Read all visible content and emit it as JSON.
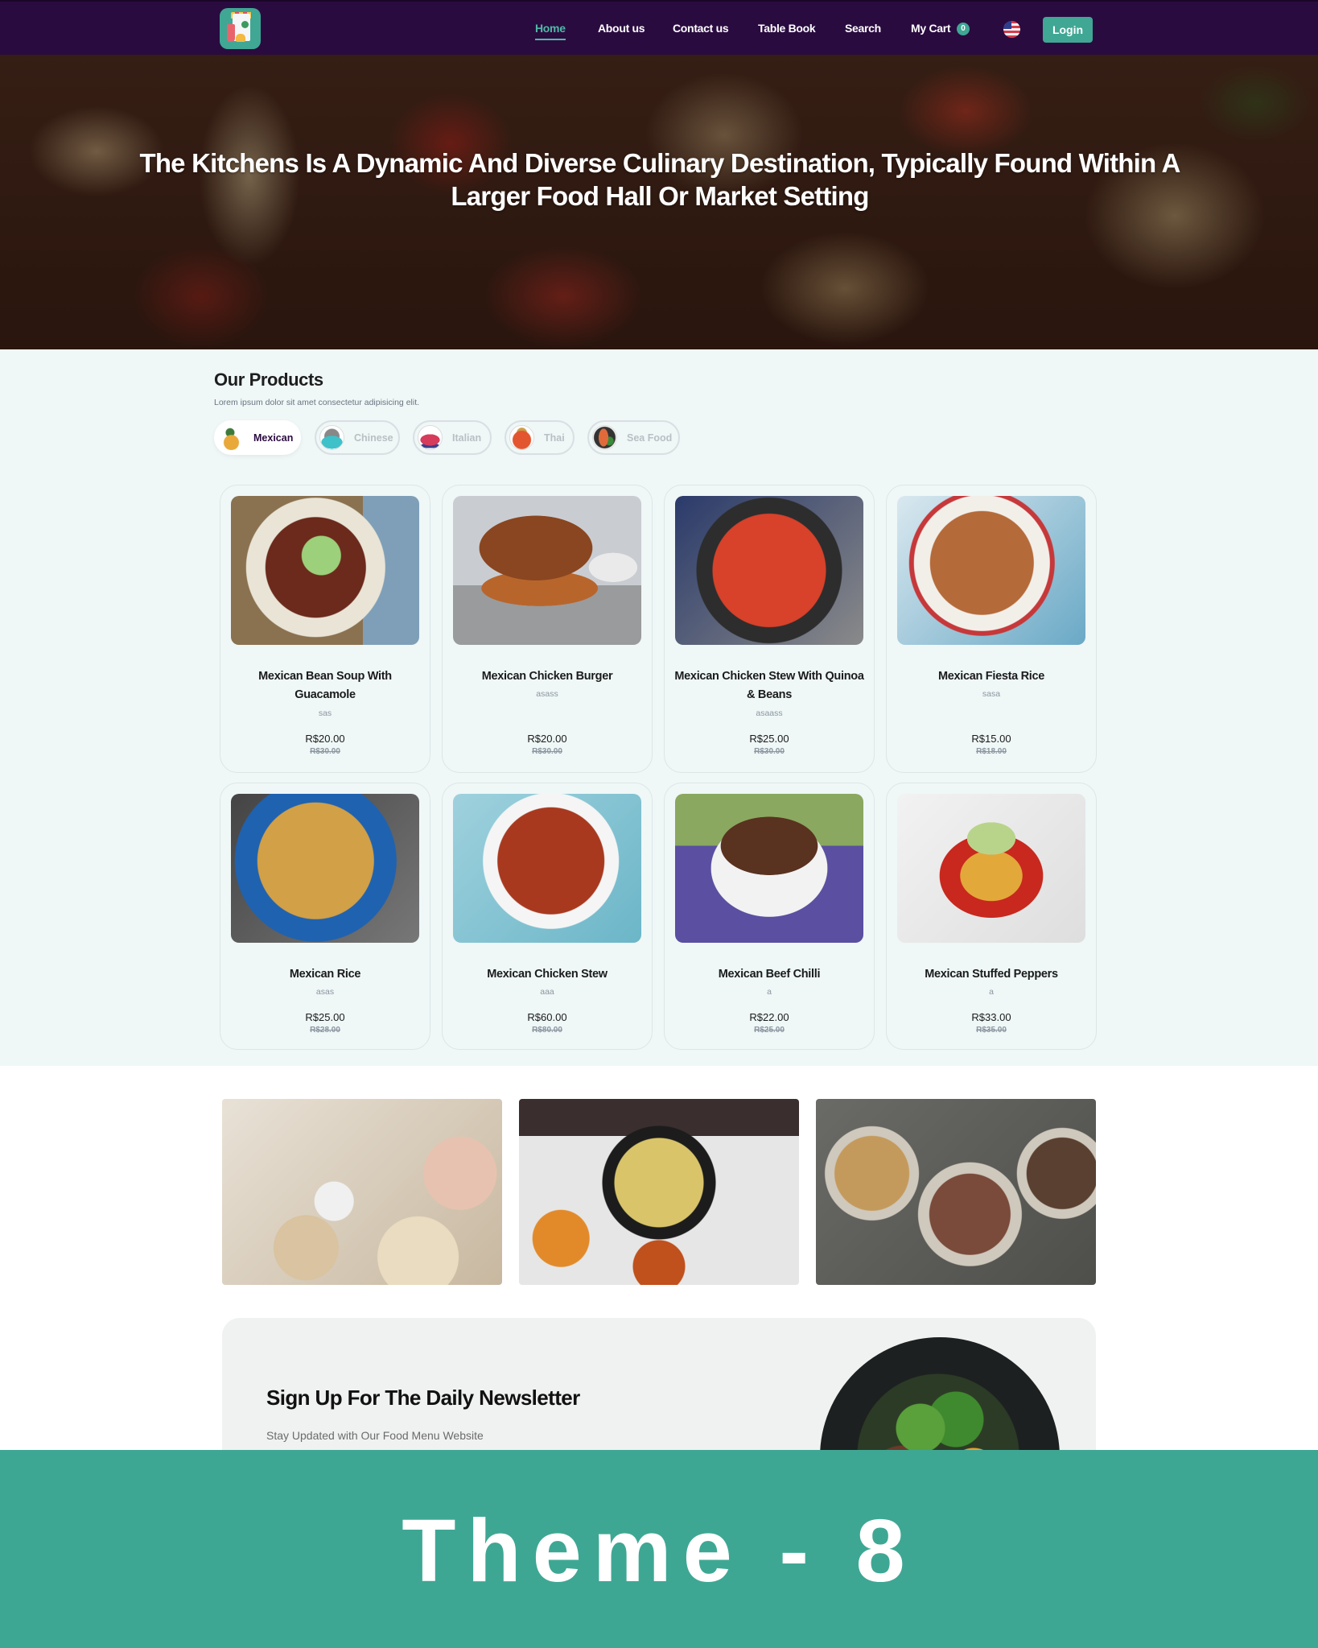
{
  "nav": {
    "logo_alt": "Food shop logo",
    "links": [
      {
        "label": "Home",
        "active": true
      },
      {
        "label": "About us",
        "active": false
      },
      {
        "label": "Contact us",
        "active": false
      },
      {
        "label": "Table Book",
        "active": false
      },
      {
        "label": "Search",
        "active": false
      },
      {
        "label": "My Cart",
        "active": false
      }
    ],
    "cart_count": "0",
    "language_icon": "us-flag-icon",
    "login_label": "Login"
  },
  "hero": {
    "title": "The Kitchens Is A Dynamic And Diverse Culinary Destination, Typically Found Within A Larger Food Hall Or Market Setting"
  },
  "products": {
    "title": "Our Products",
    "subtitle": "Lorem ipsum dolor sit amet consectetur adipisicing elit.",
    "categories": [
      {
        "label": "Mexican",
        "icon": "mexican-dish-icon",
        "active": true
      },
      {
        "label": "Chinese",
        "icon": "noodle-bowl-icon",
        "active": false
      },
      {
        "label": "Italian",
        "icon": "italian-dish-icon",
        "active": false
      },
      {
        "label": "Thai",
        "icon": "thai-bowl-icon",
        "active": false
      },
      {
        "label": "Sea Food",
        "icon": "lobster-icon",
        "active": false
      }
    ],
    "items": [
      {
        "name": "Mexican Bean Soup With Guacamole",
        "desc": "sas",
        "price": "R$20.00",
        "old_price": "R$30.00"
      },
      {
        "name": "Mexican Chicken Burger",
        "desc": "asass",
        "price": "R$20.00",
        "old_price": "R$30.00"
      },
      {
        "name": "Mexican Chicken Stew With Quinoa & Beans",
        "desc": "asaass",
        "price": "R$25.00",
        "old_price": "R$30.00"
      },
      {
        "name": "Mexican Fiesta Rice",
        "desc": "sasa",
        "price": "R$15.00",
        "old_price": "R$18.00"
      },
      {
        "name": "Mexican Rice",
        "desc": "asas",
        "price": "R$25.00",
        "old_price": "R$28.00"
      },
      {
        "name": "Mexican Chicken Stew",
        "desc": "aaa",
        "price": "R$60.00",
        "old_price": "R$80.00"
      },
      {
        "name": "Mexican Beef Chilli",
        "desc": "a",
        "price": "R$22.00",
        "old_price": "R$25.00"
      },
      {
        "name": "Mexican Stuffed Peppers",
        "desc": "a",
        "price": "R$33.00",
        "old_price": "R$35.00"
      }
    ]
  },
  "newsletter": {
    "title": "Sign Up For The Daily Newsletter",
    "subtitle": "Stay Updated with Our Food Menu Website"
  },
  "banner": {
    "text": "Theme - 8"
  },
  "colors": {
    "nav_bg": "#2a0b40",
    "accent": "#3fa794",
    "products_bg": "#eff7f7",
    "banner_bg": "#3ea794"
  }
}
